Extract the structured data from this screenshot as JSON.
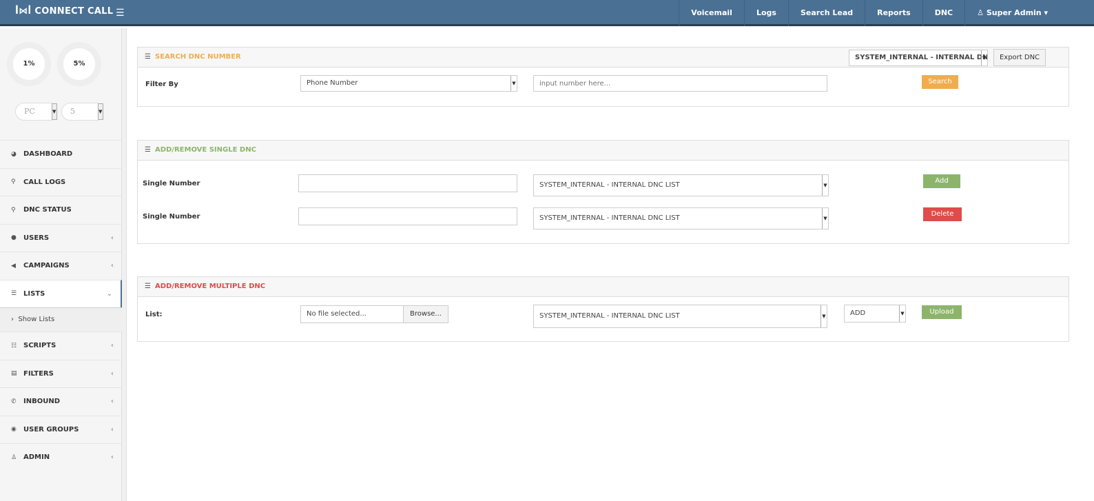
{
  "app": {
    "title": "CONNECT CALL"
  },
  "nav": [
    "Voicemail",
    "Logs",
    "Search Lead",
    "Reports",
    "DNC",
    "Super Admin"
  ],
  "gauges": [
    "1%",
    "5%"
  ],
  "selects": [
    "PC",
    "5"
  ],
  "menu": [
    {
      "label": "DASHBOARD",
      "icon": "dashboard-icon",
      "glyph": "◕"
    },
    {
      "label": "CALL LOGS",
      "icon": "search-icon",
      "glyph": "⚲"
    },
    {
      "label": "DNC STATUS",
      "icon": "search-icon",
      "glyph": "⚲"
    },
    {
      "label": "USERS",
      "icon": "user-icon",
      "glyph": "●"
    },
    {
      "label": "CAMPAIGNS",
      "icon": "bullhorn-icon",
      "glyph": "◀"
    },
    {
      "label": "LISTS",
      "icon": "list-icon",
      "glyph": "☰"
    },
    {
      "label": "SCRIPTS",
      "icon": "list-ul-icon",
      "glyph": "☷"
    },
    {
      "label": "FILTERS",
      "icon": "file-icon",
      "glyph": "▤"
    },
    {
      "label": "INBOUND",
      "icon": "phone-icon",
      "glyph": "✆"
    },
    {
      "label": "USER GROUPS",
      "icon": "users-icon",
      "glyph": "◉"
    },
    {
      "label": "ADMIN",
      "icon": "admin-icon",
      "glyph": "♙"
    }
  ],
  "submenu": {
    "show_lists": "Show Lists"
  },
  "search_panel": {
    "title": "SEARCH DNC NUMBER",
    "list_select": "SYSTEM_INTERNAL - INTERNAL DNC LIST",
    "export": "Export DNC",
    "filter_label": "Filter By",
    "filter_value": "Phone Number",
    "placeholder": "input number here...",
    "search": "Search",
    "color": "#f0ad4e"
  },
  "single_panel": {
    "title": "ADD/REMOVE SINGLE DNC",
    "label": "Single Number",
    "list": "SYSTEM_INTERNAL - INTERNAL DNC LIST",
    "add": "Add",
    "delete": "Delete",
    "color": "#8cb56b"
  },
  "multi_panel": {
    "title": "ADD/REMOVE MULTIPLE DNC",
    "label": "List:",
    "file": "No file selected...",
    "browse": "Browse...",
    "list": "SYSTEM_INTERNAL - INTERNAL DNC LIST",
    "action": "ADD",
    "upload": "Upload",
    "color": "#e04b4b"
  }
}
